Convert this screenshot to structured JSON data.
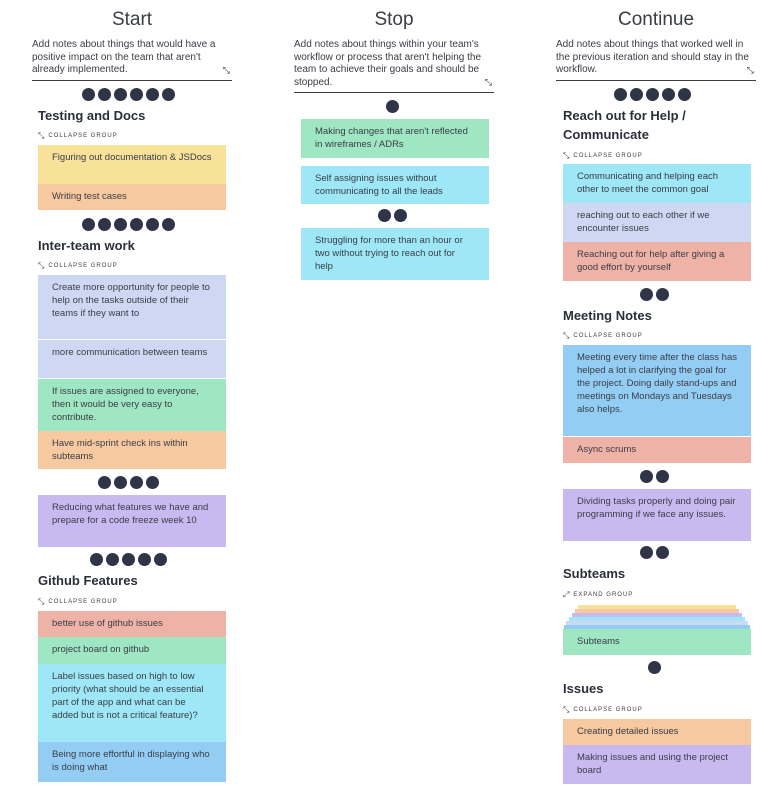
{
  "columns": {
    "start": {
      "title": "Start",
      "description": "Add notes about things that would have a positive impact on the team that aren't already implemented."
    },
    "stop": {
      "title": "Stop",
      "description": "Add notes about things within your team's workflow or process that aren't helping the team to achieve their goals and should be stopped."
    },
    "continue": {
      "title": "Continue",
      "description": "Add notes about things that worked well in the previous iteration and should stay in the workflow."
    }
  },
  "labels": {
    "collapse_group": "COLLAPSE GROUP",
    "expand_group": "EXPAND GROUP",
    "shrink_glyph": "⤡"
  },
  "start": {
    "groups": [
      {
        "title": "Testing and Docs",
        "notes": [
          "Figuring out documentation & JSDocs",
          "Writing test cases"
        ]
      },
      {
        "title": "Inter-team work",
        "notes": [
          "Create more opportunity for people to help on the tasks outside of their teams if they want to",
          "more communication between teams",
          "If issues are assigned to everyone, then it would be very easy to contribute.",
          "Have mid-sprint check ins within subteams"
        ]
      },
      {
        "title": "Github Features",
        "notes": [
          "better use of github issues",
          "project board on github",
          "Label issues based on high to low priority (what should be an essential part of the app and what can be added but is not a critical feature)?",
          "Being more effortful in displaying who is doing what"
        ]
      }
    ],
    "loose_notes": [
      "Reducing what features we have and prepare for a code freeze week 10"
    ]
  },
  "stop": {
    "notes": [
      "Making changes that aren't reflected in wireframes / ADRs",
      "Self assigning issues without communicating to all the leads",
      "Struggling for more than an hour or two without trying to reach out for help"
    ]
  },
  "continue": {
    "groups": [
      {
        "title": "Reach out for Help / Communicate",
        "notes": [
          "Communicating and helping each other to meet the common goal",
          "reaching out to each other if we encounter issues",
          "Reaching out for help after giving a good effort by yourself"
        ]
      },
      {
        "title": "Meeting Notes",
        "notes": [
          "Meeting every time after the class has helped a lot in clarifying the goal for the project. Doing daily stand-ups and meetings on Mondays and Tuesdays also helps.",
          "Async scrums"
        ]
      },
      {
        "title": "Subteams",
        "notes": [
          "Subteams"
        ]
      },
      {
        "title": "Issues",
        "notes": [
          "Creating detailed issues",
          "Making issues and using the project board"
        ]
      }
    ],
    "loose_notes": [
      "Dividing tasks properly and doing pair programming if we face any issues."
    ]
  },
  "colors": {
    "yellow": "#f8e29a",
    "orange": "#f6c9a0",
    "red": "#efb2a7",
    "lavender": "#cfd8f3",
    "green": "#9fe6c3",
    "cyan": "#9ee7f6",
    "blue": "#93cdf4",
    "purple": "#c9b9f1",
    "dot": "#2f3547"
  }
}
